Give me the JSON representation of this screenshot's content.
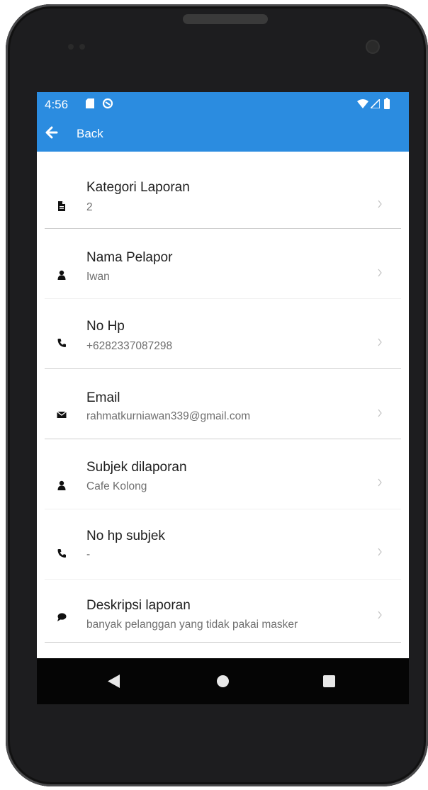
{
  "statusbar": {
    "time": "4:56",
    "icons": [
      "sd-card-icon",
      "sync-icon",
      "wifi-icon",
      "signal-icon",
      "battery-icon"
    ]
  },
  "appbar": {
    "back_label": "Back",
    "back_icon": "arrow-left-icon"
  },
  "items": [
    {
      "title": "Kategori Laporan",
      "value": "2",
      "icon": "file-icon"
    },
    {
      "title": "Nama Pelapor",
      "value": "Iwan",
      "icon": "user-icon"
    },
    {
      "title": "No Hp",
      "value": "+6282337087298",
      "icon": "phone-icon"
    },
    {
      "title": "Email",
      "value": "rahmatkurniawan339@gmail.com",
      "icon": "envelope-icon"
    },
    {
      "title": "Subjek dilaporan",
      "value": "Cafe Kolong",
      "icon": "user-icon"
    },
    {
      "title": "No hp subjek",
      "value": "-",
      "icon": "phone-icon"
    },
    {
      "title": "Deskripsi laporan",
      "value": "banyak pelanggan yang tidak pakai masker",
      "icon": "comment-icon"
    }
  ],
  "navbar": {
    "icons": [
      "nav-back-icon",
      "nav-home-icon",
      "nav-recents-icon"
    ]
  },
  "colors": {
    "primary": "#2b8ce0",
    "text_primary": "#1f1f1f",
    "text_secondary": "#6f6f6f",
    "divider": "#cfcfcf",
    "navbar": "#050505"
  }
}
